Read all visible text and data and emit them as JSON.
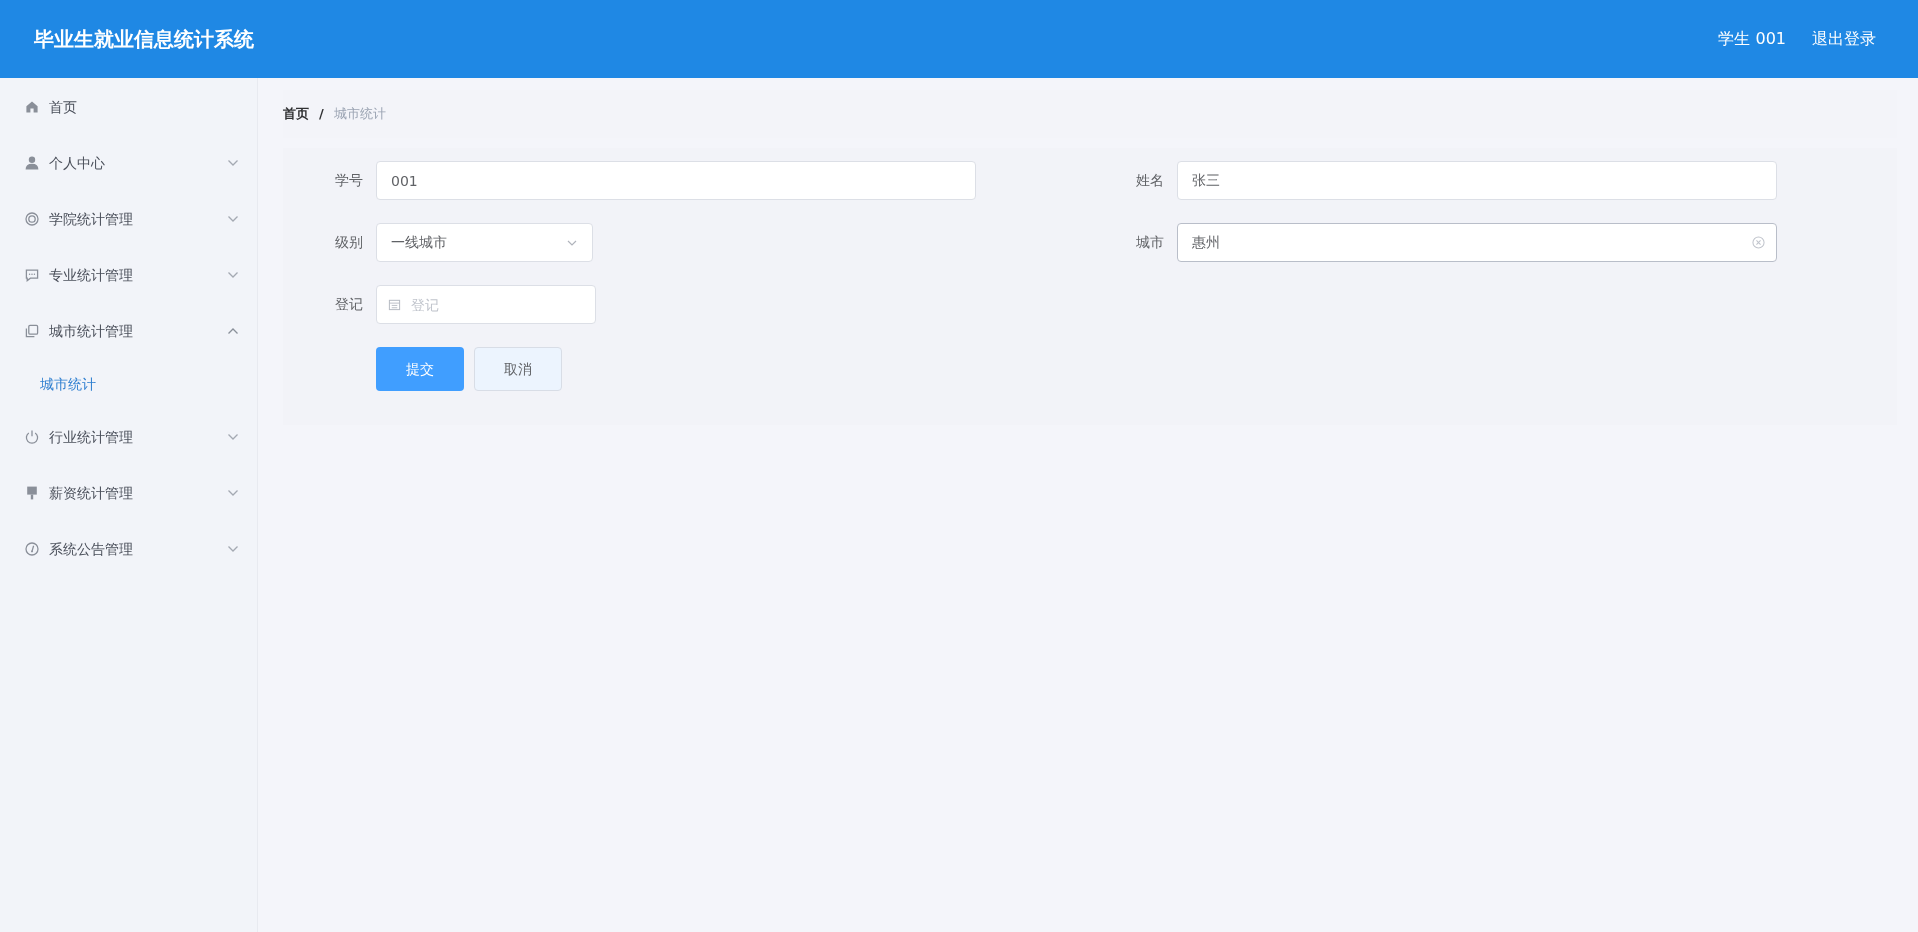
{
  "header": {
    "title": "毕业生就业信息统计系统",
    "user": "学生 001",
    "logout": "退出登录"
  },
  "sidebar": {
    "items": [
      {
        "label": "首页",
        "kind": "link"
      },
      {
        "label": "个人中心",
        "kind": "submenu",
        "expanded": false
      },
      {
        "label": "学院统计管理",
        "kind": "submenu",
        "expanded": false
      },
      {
        "label": "专业统计管理",
        "kind": "submenu",
        "expanded": false
      },
      {
        "label": "城市统计管理",
        "kind": "submenu",
        "expanded": true,
        "children": [
          {
            "label": "城市统计",
            "selected": true
          }
        ]
      },
      {
        "label": "行业统计管理",
        "kind": "submenu",
        "expanded": false
      },
      {
        "label": "薪资统计管理",
        "kind": "submenu",
        "expanded": false
      },
      {
        "label": "系统公告管理",
        "kind": "submenu",
        "expanded": false
      }
    ]
  },
  "breadcrumb": {
    "separator": "/",
    "items": [
      {
        "label": "首页",
        "current": false
      },
      {
        "label": "城市统计",
        "current": true
      }
    ]
  },
  "form": {
    "left": [
      {
        "label": "学号",
        "kind": "text",
        "value": "001",
        "focused": false
      },
      {
        "label": "级别",
        "kind": "select",
        "value": "一线城市",
        "focused": false
      },
      {
        "label": "登记",
        "kind": "date",
        "placeholder": "登记",
        "focused": false
      }
    ],
    "right": [
      {
        "label": "姓名",
        "kind": "text",
        "value": "张三",
        "focused": false
      },
      {
        "label": "城市",
        "kind": "text",
        "value": "惠州",
        "focused": true
      }
    ],
    "buttons": [
      {
        "label": "提交",
        "kind": "primary"
      },
      {
        "label": "取消",
        "kind": "secondary"
      }
    ]
  }
}
